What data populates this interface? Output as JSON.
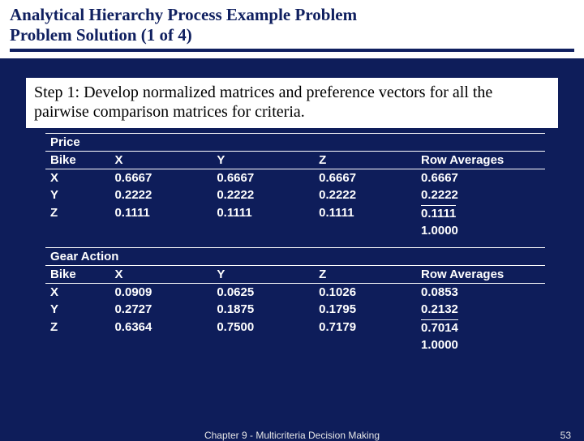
{
  "title": {
    "line1": "Analytical Hierarchy Process Example Problem",
    "line2": "Problem Solution (1 of 4)"
  },
  "step_text": "Step 1: Develop normalized matrices and preference vectors for all the pairwise comparison matrices for criteria.",
  "headers": {
    "bike": "Bike",
    "x": "X",
    "y": "Y",
    "z": "Z",
    "avg": "Row Averages"
  },
  "table1": {
    "criterion": "Price",
    "rows": [
      {
        "label": "X",
        "x": "0.6667",
        "y": "0.6667",
        "z": "0.6667",
        "avg": "0.6667"
      },
      {
        "label": "Y",
        "x": "0.2222",
        "y": "0.2222",
        "z": "0.2222",
        "avg": "0.2222"
      },
      {
        "label": "Z",
        "x": "0.1111",
        "y": "0.1111",
        "z": "0.1111",
        "avg": "0.1111"
      }
    ],
    "sum": "1.0000"
  },
  "table2": {
    "criterion": "Gear Action",
    "rows": [
      {
        "label": "X",
        "x": "0.0909",
        "y": "0.0625",
        "z": "0.1026",
        "avg": "0.0853"
      },
      {
        "label": "Y",
        "x": "0.2727",
        "y": "0.1875",
        "z": "0.1795",
        "avg": "0.2132"
      },
      {
        "label": "Z",
        "x": "0.6364",
        "y": "0.7500",
        "z": "0.7179",
        "avg": "0.7014"
      }
    ],
    "sum": "1.0000"
  },
  "footer": {
    "chapter": "Chapter 9 - Multicriteria Decision Making",
    "page": "53"
  },
  "chart_data": [
    {
      "type": "table",
      "title": "Price",
      "columns": [
        "Bike",
        "X",
        "Y",
        "Z",
        "Row Averages"
      ],
      "rows": [
        [
          "X",
          0.6667,
          0.6667,
          0.6667,
          0.6667
        ],
        [
          "Y",
          0.2222,
          0.2222,
          0.2222,
          0.2222
        ],
        [
          "Z",
          0.1111,
          0.1111,
          0.1111,
          0.1111
        ]
      ],
      "sum_row_averages": 1.0
    },
    {
      "type": "table",
      "title": "Gear Action",
      "columns": [
        "Bike",
        "X",
        "Y",
        "Z",
        "Row Averages"
      ],
      "rows": [
        [
          "X",
          0.0909,
          0.0625,
          0.1026,
          0.0853
        ],
        [
          "Y",
          0.2727,
          0.1875,
          0.1795,
          0.2132
        ],
        [
          "Z",
          0.6364,
          0.75,
          0.7179,
          0.7014
        ]
      ],
      "sum_row_averages": 1.0
    }
  ]
}
